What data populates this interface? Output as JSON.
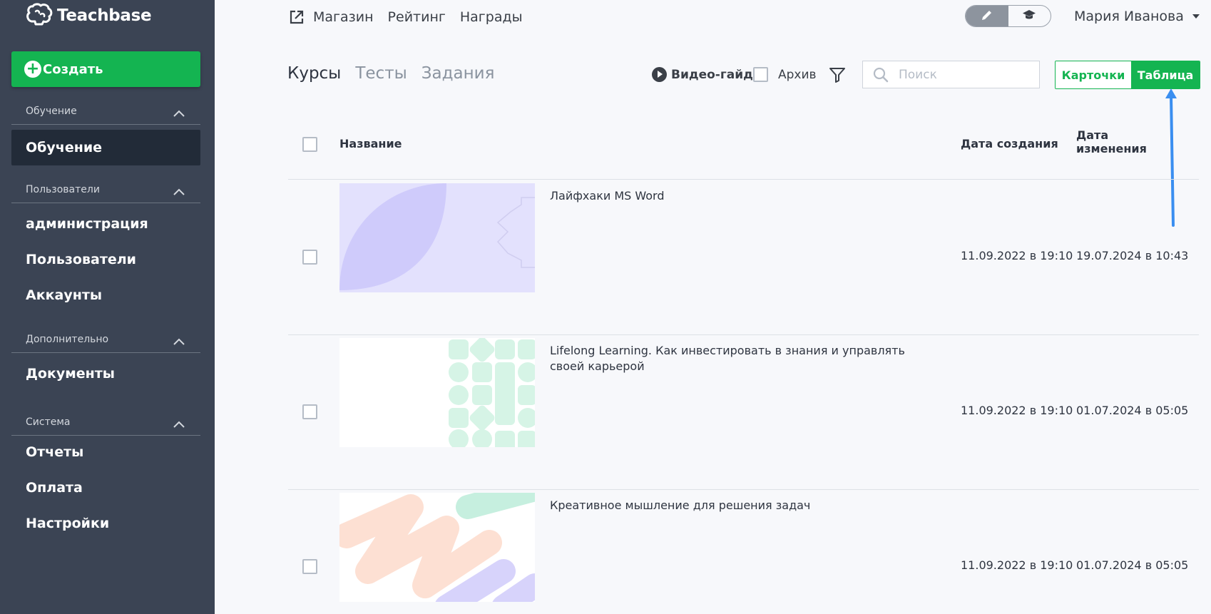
{
  "app": {
    "name": "Teachbase"
  },
  "sidebar": {
    "create_label": "Создать",
    "sections": [
      {
        "title": "Обучение",
        "items": [
          "Обучение"
        ]
      },
      {
        "title": "Пользователи",
        "items": [
          "администрация",
          "Пользователи",
          "Аккаунты"
        ]
      },
      {
        "title": "Дополнительно",
        "items": [
          "Документы"
        ]
      },
      {
        "title": "Система",
        "items": [
          "Отчеты",
          "Оплата",
          "Настройки"
        ]
      }
    ],
    "active_item": "Обучение"
  },
  "topnav": {
    "links": [
      "Магазин",
      "Рейтинг",
      "Награды"
    ],
    "mode_icons": [
      "pencil-icon",
      "graduation-cap-icon"
    ],
    "user_name": "Мария Иванова"
  },
  "toolbar": {
    "tabs": [
      "Курсы",
      "Тесты",
      "Задания"
    ],
    "active_tab": "Курсы",
    "video_guide": "Видео-гайд",
    "archive_label": "Архив",
    "search_placeholder": "Поиск",
    "view_cards": "Карточки",
    "view_table": "Таблица",
    "active_view": "Таблица"
  },
  "table": {
    "columns": {
      "name": "Название",
      "created": "Дата создания",
      "modified_line1": "Дата",
      "modified_line2": "изменения"
    },
    "rows": [
      {
        "name": "Лайфхаки MS Word",
        "created": "11.09.2022 в 19:10",
        "modified": "19.07.2024 в 10:43"
      },
      {
        "name": "Lifelong Learning. Как инвестировать в знания и управлять своей карьерой",
        "created": "11.09.2022 в 19:10",
        "modified": "01.07.2024 в 05:05"
      },
      {
        "name": "Креативное мышление для решения задач",
        "created": "11.09.2022 в 19:10",
        "modified": "01.07.2024 в 05:05"
      }
    ]
  },
  "colors": {
    "sidebar_bg": "#3b4454",
    "sidebar_active_bg": "#222b38",
    "accent_green": "#14b451",
    "annotation_arrow": "#3a8ef0"
  }
}
